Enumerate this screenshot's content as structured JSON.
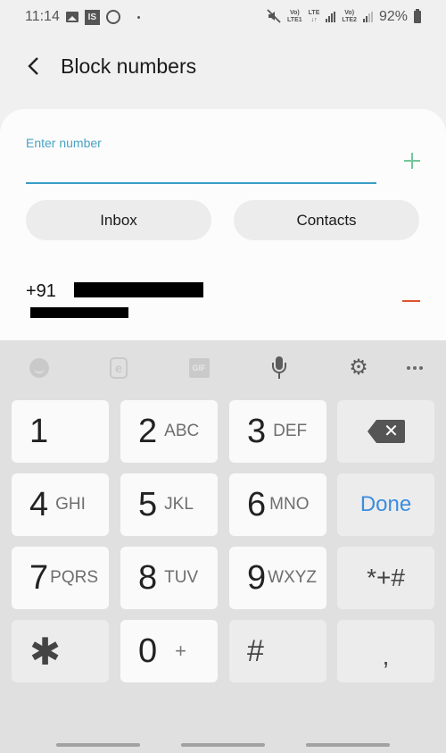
{
  "status_bar": {
    "time": "11:14",
    "notification_icons": [
      "image-icon",
      "is-app-icon",
      "whatsapp-icon",
      "more-notifications-dot"
    ],
    "is_label": "IS",
    "sim1": {
      "top": "Vo)",
      "bottom": "LTE1"
    },
    "data": {
      "top": "LTE",
      "bottom": "↓↑"
    },
    "sim2": {
      "top": "Vo)",
      "bottom": "LTE2"
    },
    "battery_percent": "92%",
    "mute_glyph": "🔇"
  },
  "header": {
    "back_icon": "chevron-left-icon",
    "title": "Block numbers"
  },
  "block_form": {
    "input_label": "Enter number",
    "input_value": "",
    "add_icon": "plus-icon",
    "add_color": "#74c79a",
    "underline_color": "#3a9cc5",
    "buttons": {
      "inbox": "Inbox",
      "contacts": "Contacts"
    }
  },
  "blocked_list": [
    {
      "number_visible_prefix": "+91",
      "number_redacted": true,
      "name_redacted": true,
      "remove_icon": "minus-icon",
      "remove_color": "#e2532d"
    }
  ],
  "keyboard": {
    "toolbar": [
      "emoji-icon",
      "sticker-icon",
      "gif-icon",
      "mic-icon",
      "gear-icon",
      "more-icon"
    ],
    "gif_label": "GIF",
    "sticker_glyph": "e",
    "gear_glyph": "⚙",
    "keys": {
      "k1": {
        "num": "1",
        "letters": ""
      },
      "k2": {
        "num": "2",
        "letters": "ABC"
      },
      "k3": {
        "num": "3",
        "letters": "DEF"
      },
      "k4": {
        "num": "4",
        "letters": "GHI"
      },
      "k5": {
        "num": "5",
        "letters": "JKL"
      },
      "k6": {
        "num": "6",
        "letters": "MNO"
      },
      "k7": {
        "num": "7",
        "letters": "PQRS"
      },
      "k8": {
        "num": "8",
        "letters": "TUV"
      },
      "k9": {
        "num": "9",
        "letters": "WXYZ"
      },
      "k0": {
        "num": "0",
        "letters": "+"
      },
      "star": "✱",
      "hash": "#",
      "symbols": "*+#",
      "comma": ",",
      "done": "Done",
      "backspace_glyph": "✕"
    },
    "done_color": "#3b8de0"
  },
  "nav_bar": [
    "recents",
    "home",
    "back"
  ]
}
